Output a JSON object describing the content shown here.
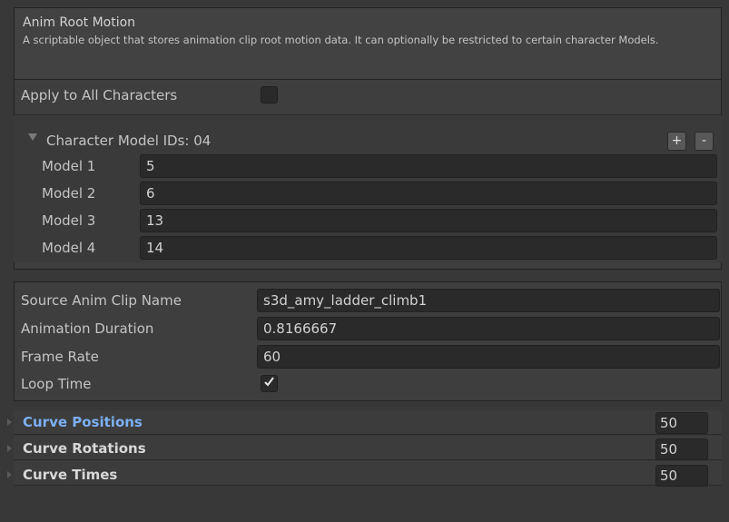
{
  "header": {
    "title": "Anim Root Motion",
    "description": "A scriptable object that stores animation clip root motion data. It can optionally be restricted to certain character Models."
  },
  "apply_all": {
    "label": "Apply to All Characters",
    "checked": false
  },
  "character_models": {
    "label": "Character Model IDs: 04",
    "add_label": "+",
    "remove_label": "-",
    "items": [
      {
        "label": "Model 1",
        "value": "5"
      },
      {
        "label": "Model 2",
        "value": "6"
      },
      {
        "label": "Model 3",
        "value": "13"
      },
      {
        "label": "Model 4",
        "value": "14"
      }
    ]
  },
  "clip": {
    "source_label": "Source Anim Clip Name",
    "source_value": "s3d_amy_ladder_climb1",
    "duration_label": "Animation Duration",
    "duration_value": "0.8166667",
    "frame_rate_label": "Frame Rate",
    "frame_rate_value": "60",
    "loop_label": "Loop Time",
    "loop_checked": true
  },
  "curves": [
    {
      "label": "Curve Positions",
      "value": "50",
      "active": true
    },
    {
      "label": "Curve Rotations",
      "value": "50",
      "active": false
    },
    {
      "label": "Curve Times",
      "value": "50",
      "active": false
    }
  ],
  "colors": {
    "background": "#383838",
    "field": "#2a2a2a",
    "active_label": "#7cb0f4"
  }
}
